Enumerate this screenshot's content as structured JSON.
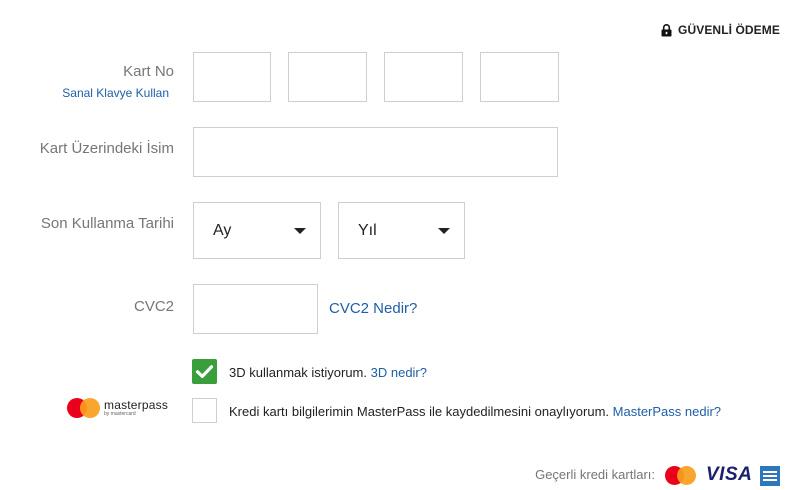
{
  "header": {
    "secure_label": "GÜVENLİ ÖDEME"
  },
  "form": {
    "card_no_label": "Kart No",
    "virtual_keyboard_link": "Sanal Klavye Kullan",
    "card_no_segments": [
      "",
      "",
      "",
      ""
    ],
    "card_name_label": "Kart Üzerindeki İsim",
    "card_name_value": "",
    "expiry_label": "Son Kullanma Tarihi",
    "month_select": "Ay",
    "year_select": "Yıl",
    "cvc_label": "CVC2",
    "cvc_value": "",
    "cvc_help_link": "CVC2 Nedir?"
  },
  "options": {
    "three_d": {
      "checked": true,
      "text": "3D kullanmak istiyorum.",
      "link": "3D nedir?"
    },
    "masterpass": {
      "checked": false,
      "text": "Kredi kartı bilgilerimin MasterPass ile kaydedilmesini onaylıyorum.",
      "link": "MasterPass nedir?",
      "logo_text": "masterpass",
      "logo_subtext": "by mastercard"
    }
  },
  "footer": {
    "valid_cards_label": "Geçerli kredi kartları:",
    "cards": [
      "mastercard-icon",
      "visa-icon",
      "amex-icon"
    ],
    "visa_text": "VISA"
  },
  "colors": {
    "link": "#1f5fa8",
    "check_on": "#3a9e3a",
    "border": "#cfcfcf",
    "label": "#767676"
  }
}
